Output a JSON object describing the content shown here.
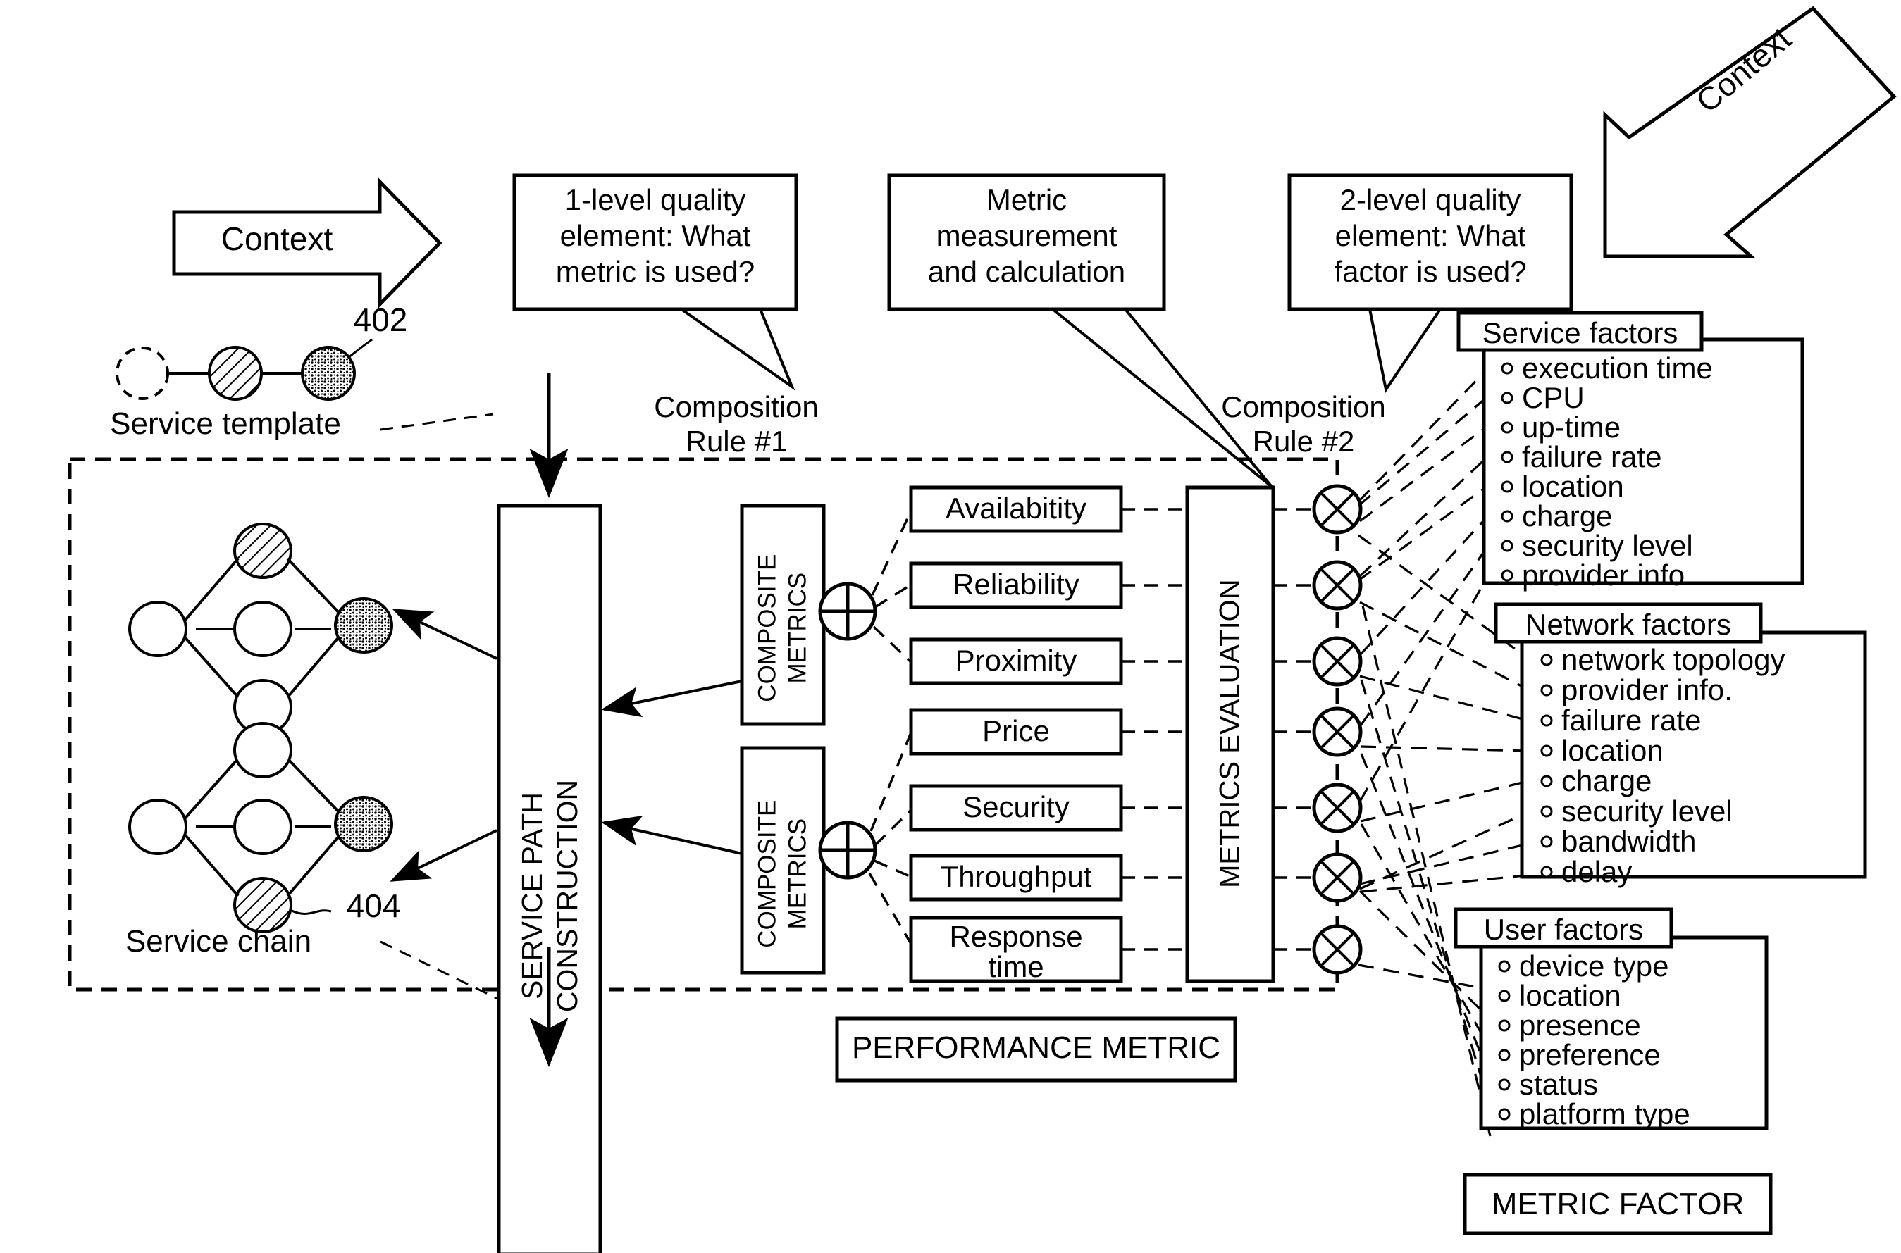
{
  "figure": {
    "reference_numerals": [
      "402",
      "404"
    ],
    "context_arrows": [
      {
        "label": "Context",
        "direction": "right"
      },
      {
        "label": "Context",
        "direction": "down-left"
      }
    ],
    "callouts": [
      {
        "text": "1-level quality\nelement: What\nmetric is used?"
      },
      {
        "text": "Metric\nmeasurement\nand calculation"
      },
      {
        "text": "2-level quality\nelement: What\nfactor is used?"
      }
    ],
    "composition_rules": [
      {
        "text": "Composition\nRule #1"
      },
      {
        "text": "Composition\nRule #2"
      }
    ],
    "left_labels": {
      "service_template": "Service template",
      "service_chain": "Service chain",
      "numeral_template": "402",
      "numeral_chain": "404"
    },
    "process_blocks": {
      "service_path_construction": "SERVICE PATH\nCONSTRUCTION",
      "composite_metrics_top": "COMPOSITE\nMETRICS",
      "composite_metrics_bottom": "COMPOSITE\nMETRICS",
      "metrics_evaluation": "METRICS EVALUATION"
    },
    "metrics": [
      "Availabitity",
      "Reliability",
      "Proximity",
      "Price",
      "Security",
      "Throughput",
      "Response\ntime"
    ],
    "group_labels": {
      "performance_metric": "PERFORMANCE METRIC",
      "metric_factor": "METRIC FACTOR"
    },
    "factor_boxes": [
      {
        "title": "Service factors",
        "items": [
          "execution time",
          "CPU",
          "up-time",
          "failure rate",
          "location",
          "charge",
          "security level",
          "provider info."
        ]
      },
      {
        "title": "Network factors",
        "items": [
          "network topology",
          "provider info.",
          "failure rate",
          "location",
          "charge",
          "security level",
          "bandwidth",
          "delay"
        ]
      },
      {
        "title": "User factors",
        "items": [
          "device type",
          "location",
          "presence",
          "preference",
          "status",
          "platform type"
        ]
      }
    ],
    "symbols": {
      "sum_node": "plus-circle",
      "product_node": "cross-circle",
      "bullet": "hollow-circle"
    },
    "colors": {
      "stroke": "#000000",
      "background": "#ffffff"
    }
  }
}
